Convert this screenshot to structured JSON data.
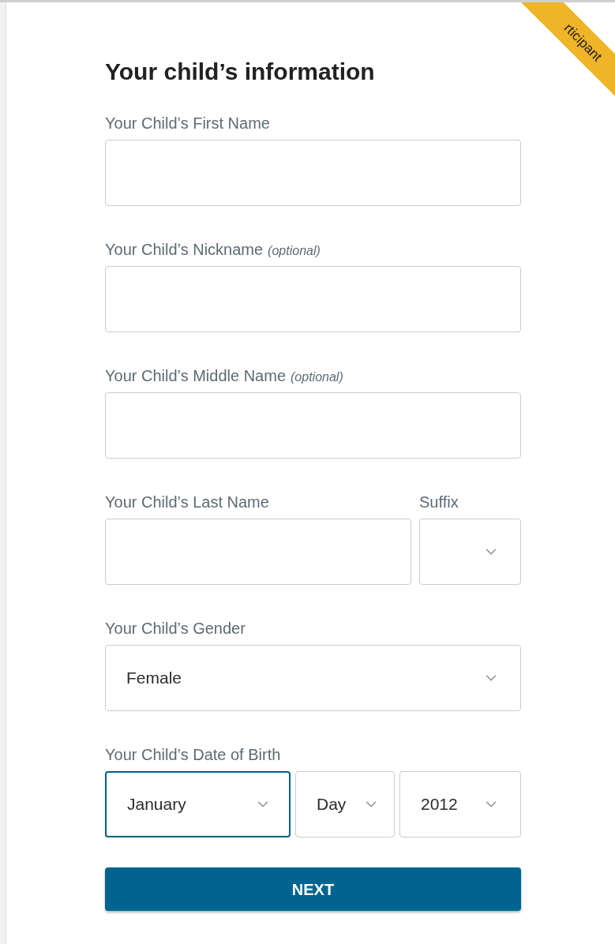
{
  "ribbon": {
    "label": "rticipant"
  },
  "heading": "Your child’s information",
  "rows": [
    {
      "groups": [
        {
          "label": "Your Child’s First Name",
          "controls": [
            {
              "kind": "text",
              "focused": false
            }
          ]
        }
      ]
    },
    {
      "groups": [
        {
          "label": "Your Child’s Nickname",
          "note": "(optional)",
          "controls": [
            {
              "kind": "text",
              "focused": false
            }
          ]
        }
      ]
    },
    {
      "groups": [
        {
          "label": "Your Child’s Middle Name",
          "note": "(optional)",
          "controls": [
            {
              "kind": "text",
              "focused": false
            }
          ]
        }
      ]
    },
    {
      "groups": [
        {
          "label": "Your Child’s Last Name",
          "controls": [
            {
              "kind": "text",
              "focused": false
            }
          ]
        },
        {
          "label": "Suffix",
          "controls": [
            {
              "kind": "select",
              "focused": false
            }
          ]
        }
      ]
    },
    {
      "groups": [
        {
          "label": "Your Child’s Gender",
          "controls": [
            {
              "kind": "select",
              "value": "Female",
              "focused": false
            }
          ]
        }
      ]
    },
    {
      "groups": [
        {
          "label": "Your Child’s Date of Birth",
          "controls": [
            {
              "kind": "select",
              "value": "January",
              "focused": true
            },
            {
              "kind": "select",
              "value": "Day",
              "focused": false
            },
            {
              "kind": "select",
              "value": "2012",
              "focused": false
            }
          ]
        }
      ]
    }
  ],
  "button": {
    "label": "NEXT"
  }
}
